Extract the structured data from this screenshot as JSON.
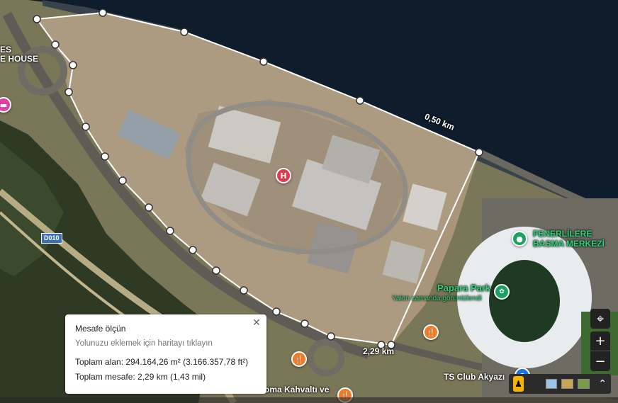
{
  "map_labels": {
    "house": "ES\nE HOUSE",
    "fenerliler": "FENERLİLERE\nBASMA MERKEZİ",
    "papara": "Papara Park",
    "papara_note": "Yakın zamanda görüntülendi",
    "ts_club": "TS Club Akyazı",
    "kahvalti": "oma Kahvaltı ve",
    "road_d010": "D010",
    "segment_top": "0,50 km",
    "segment_bottom": "2,29 km"
  },
  "info_card": {
    "title": "Mesafe ölçün",
    "hint": "Yolunuzu eklemek için haritayı tıklayın",
    "area": "Toplam alan: 294.164,26 m² (3.166.357,78 ft²)",
    "distance": "Toplam mesafe: 2,29 km (1,43 mil)",
    "close": "✕"
  },
  "controls": {
    "locate": "⌖",
    "zoom_in": "+",
    "zoom_out": "−",
    "expand": "⌃"
  },
  "colors": {
    "water": "#0e1b2a",
    "measure_line": "#ffffff",
    "hospital_pin": "#e53950",
    "green_pin": "#1aa260",
    "food_pin": "#f07b24",
    "blue_pin": "#1a73e8"
  },
  "icons": {
    "hospital": "H",
    "food": "🍴",
    "pegman": "pegman-icon"
  }
}
